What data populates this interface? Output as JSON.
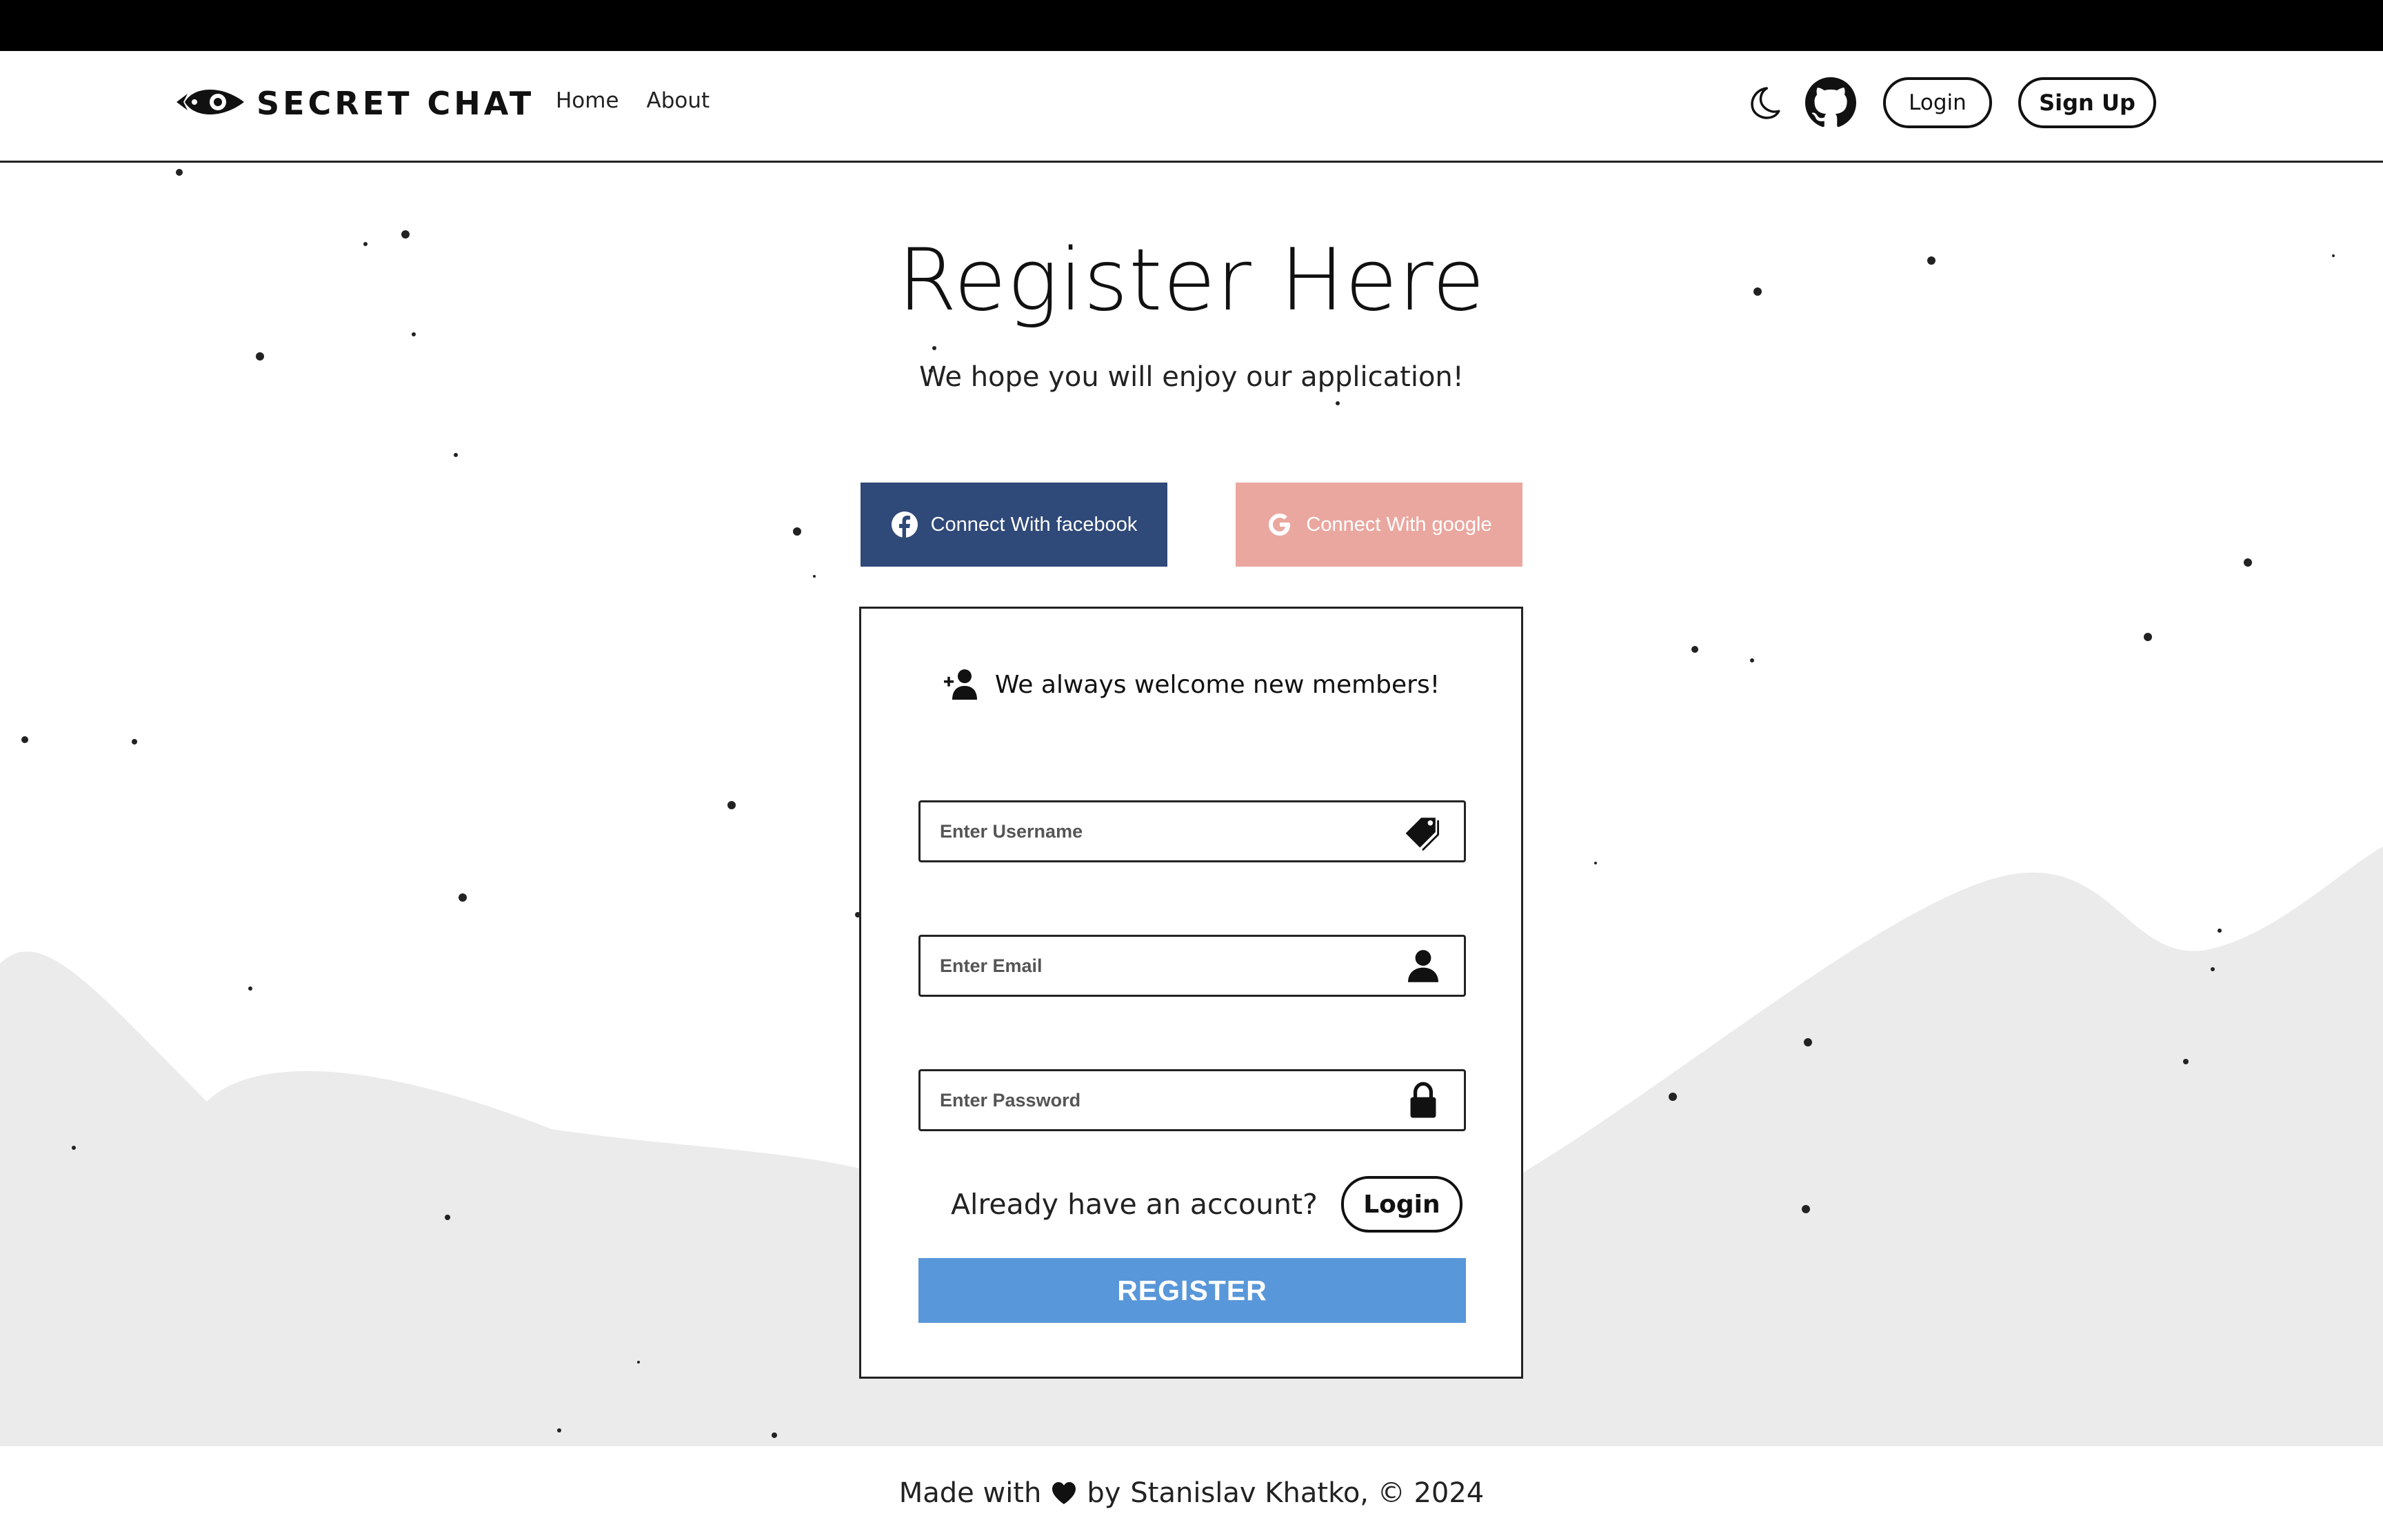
{
  "brand": {
    "name": "SECRET CHAT",
    "logo_icon": "rocket-eye-logo"
  },
  "nav": {
    "links": [
      "Home",
      "About"
    ],
    "theme_toggle_icon": "moon-icon",
    "github_icon": "github-icon",
    "login_label": "Login",
    "signup_label": "Sign Up"
  },
  "hero": {
    "title": "Register Here",
    "subtitle": "We hope you will enjoy our application!"
  },
  "social": {
    "facebook_label": "Connect With facebook",
    "google_label": "Connect With google",
    "facebook_color": "#2f4978",
    "google_color": "#eaa79f"
  },
  "form": {
    "heading": "We always welcome new members!",
    "heading_icon": "user-plus-icon",
    "username_placeholder": "Enter Username",
    "email_placeholder": "Enter Email",
    "password_placeholder": "Enter Password",
    "username_value": "",
    "email_value": "",
    "password_value": "",
    "already_text": "Already have an account?",
    "login_label": "Login",
    "register_label": "REGISTER",
    "register_color": "#5897d9"
  },
  "footer": {
    "made_with": "Made with",
    "by": "by",
    "credit": "Stanislav Khatko, © 2024"
  }
}
